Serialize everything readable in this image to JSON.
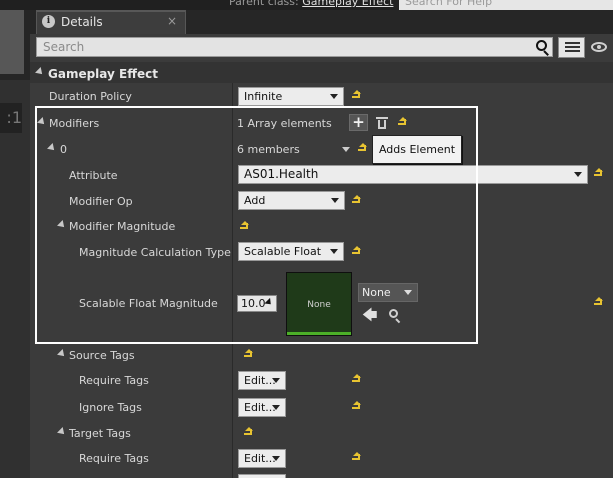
{
  "top_bar": {
    "parent_class_label": "Parent class:",
    "parent_class_value": "Gameplay Effect",
    "search_help_placeholder": "Search For Help"
  },
  "left_strip": {
    "viewport_text": ":1"
  },
  "tab": {
    "label": "Details",
    "close": "×"
  },
  "search": {
    "placeholder": "Search"
  },
  "category": {
    "title": "Gameplay Effect"
  },
  "rows": {
    "duration_policy": {
      "label": "Duration Policy",
      "value": "Infinite"
    },
    "modifiers": {
      "label": "Modifiers",
      "value": "1 Array elements",
      "add": "+"
    },
    "element_0": {
      "label": "0",
      "value": "6 members"
    },
    "attribute": {
      "label": "Attribute",
      "value": "AS01.Health"
    },
    "modifier_op": {
      "label": "Modifier Op",
      "value": "Add"
    },
    "modifier_magnitude": {
      "label": "Modifier Magnitude"
    },
    "magnitude_calc_type": {
      "label": "Magnitude Calculation Type",
      "value": "Scalable Float"
    },
    "scalable_float_magnitude": {
      "label": "Scalable Float Magnitude",
      "value": "10.0",
      "curve_thumb": "None",
      "curve_select": "None"
    },
    "source_tags": {
      "label": "Source Tags"
    },
    "source_require_tags": {
      "label": "Require Tags",
      "value": "Edit..."
    },
    "source_ignore_tags": {
      "label": "Ignore Tags",
      "value": "Edit..."
    },
    "target_tags": {
      "label": "Target Tags"
    },
    "target_require_tags": {
      "label": "Require Tags",
      "value": "Edit..."
    }
  },
  "tooltip": {
    "text": "Adds Element"
  },
  "colors": {
    "accent_reset": "#e8c431",
    "highlight_box": "#ffffff",
    "curve_bar": "#4caf28"
  }
}
